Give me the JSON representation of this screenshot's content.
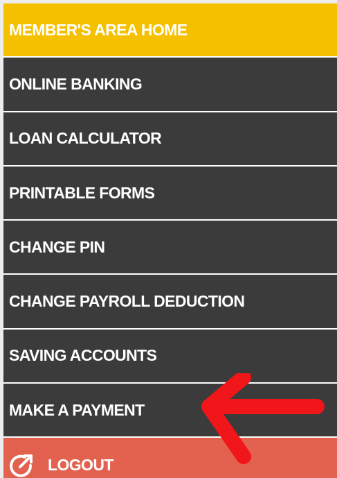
{
  "menu": {
    "items": [
      {
        "label": "MEMBER'S AREA HOME"
      },
      {
        "label": "ONLINE BANKING"
      },
      {
        "label": "LOAN CALCULATOR"
      },
      {
        "label": "PRINTABLE FORMS"
      },
      {
        "label": "CHANGE PIN"
      },
      {
        "label": "CHANGE PAYROLL DEDUCTION"
      },
      {
        "label": "SAVING ACCOUNTS"
      },
      {
        "label": "MAKE A PAYMENT"
      }
    ],
    "logout": {
      "label": "LOGOUT",
      "icon": "logout-icon"
    }
  },
  "colors": {
    "active_item": "#f5c000",
    "item_background": "#3b3b3b",
    "logout_background": "#e2614f",
    "annotation_arrow": "#f0161a"
  },
  "annotation": {
    "icon": "red-arrow-icon",
    "direction": "left"
  }
}
